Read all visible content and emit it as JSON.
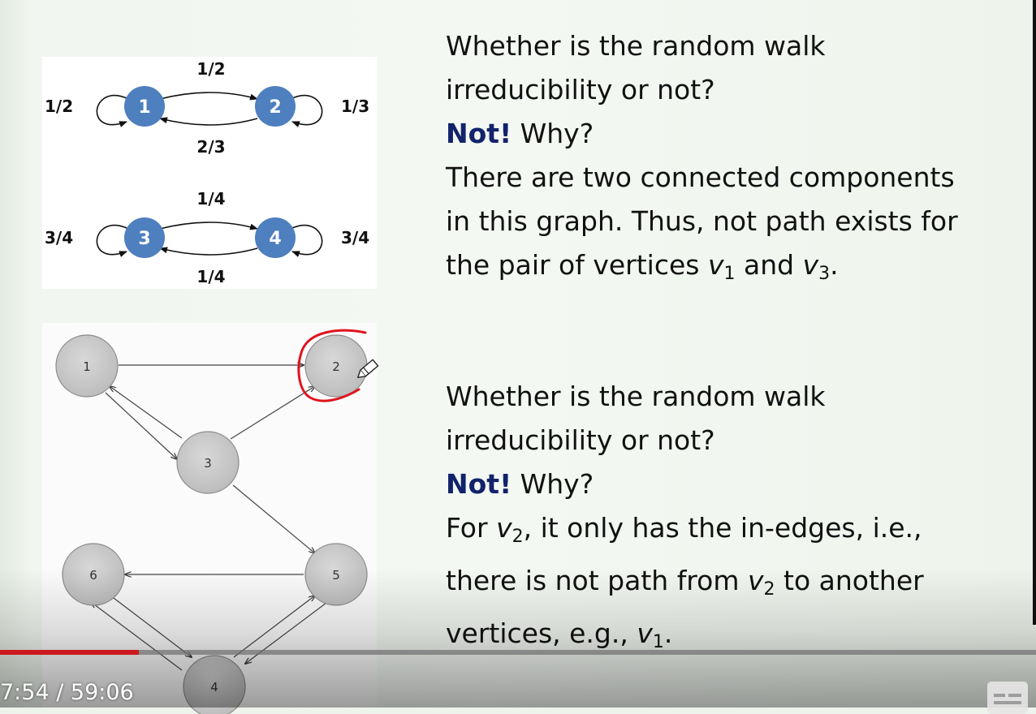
{
  "graph1": {
    "nodes": [
      "1",
      "2",
      "3",
      "4"
    ],
    "edge_labels": {
      "e12": "1/2",
      "e21": "2/3",
      "self1": "1/2",
      "self2": "1/3",
      "e34": "1/4",
      "e43": "1/4",
      "self3": "3/4",
      "self4": "3/4"
    },
    "node_color": "#4e7fbf"
  },
  "graph2": {
    "nodes": [
      "1",
      "2",
      "3",
      "4",
      "5",
      "6"
    ]
  },
  "block1": {
    "line1": "Whether is the random walk",
    "line2": "irreducibility or not?",
    "answer": "Not!",
    "why": "Why?",
    "line4": "There are two connected components",
    "line5": "in this graph. Thus, not path exists for",
    "line6_a": "the pair of vertices",
    "v": "v",
    "sub1": "1",
    "and": "and",
    "sub3": "3",
    "period": "."
  },
  "block2": {
    "line1": "Whether is the random walk",
    "line2": "irreducibility or not?",
    "answer": "Not!",
    "why": "Why?",
    "line4_a": "For",
    "v": "v",
    "sub2": "2",
    "line4_b": ", it only has the in-edges, i.e.,",
    "line5_a": "there is not path from",
    "line5_b": "to another",
    "line6_a": "vertices, e.g.,",
    "sub1": "1",
    "period": "."
  },
  "player": {
    "time_display": "7:54 / 59:06",
    "progress_fraction": 0.134
  },
  "colors": {
    "answer": "#12236b",
    "annotation": "#e0141e"
  },
  "icons": [
    "subtitles-icon",
    "pen-cursor-icon"
  ]
}
